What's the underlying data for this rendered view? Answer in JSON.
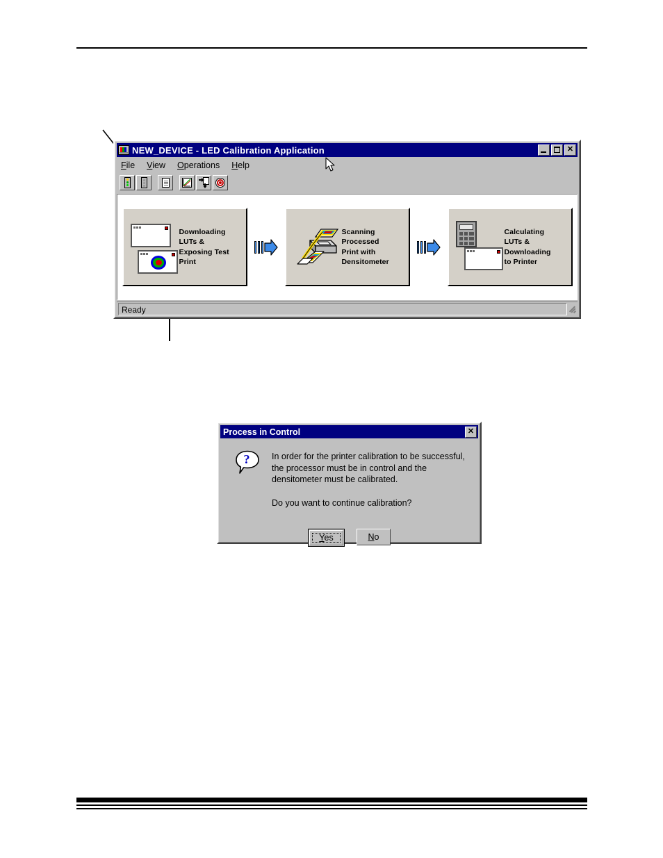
{
  "app_window": {
    "title": "NEW_DEVICE - LED Calibration Application",
    "title_icon": "device-screen-icon",
    "window_buttons": {
      "minimize": "minimize-button",
      "maximize": "maximize-button",
      "close_label": "✕"
    },
    "menu": [
      {
        "label": "File",
        "mnemonic": "F"
      },
      {
        "label": "View",
        "mnemonic": "V"
      },
      {
        "label": "Operations",
        "mnemonic": "O"
      },
      {
        "label": "Help",
        "mnemonic": "H"
      }
    ],
    "toolbar": [
      {
        "name": "status-light-on-button",
        "icon": "traffic-light-on-icon"
      },
      {
        "name": "status-light-off-button",
        "icon": "traffic-light-off-icon"
      },
      {
        "name": "report-button",
        "icon": "document-icon"
      },
      {
        "name": "curves-button",
        "icon": "graph-curve-icon"
      },
      {
        "name": "download-lut-button",
        "icon": "transfer-page-icon"
      },
      {
        "name": "calibrate-target-button",
        "icon": "bullseye-target-icon"
      }
    ],
    "flow_steps": [
      {
        "id": "step-downloading",
        "art": "monitor-and-test-print-icon",
        "lines": [
          "Downloading",
          "LUTs &",
          "Exposing Test",
          "Print"
        ]
      },
      {
        "id": "step-scanning",
        "art": "densitometer-scanner-icon",
        "lines": [
          "Scanning",
          "Processed",
          "Print with",
          "Densitometer"
        ]
      },
      {
        "id": "step-calculating",
        "art": "calculator-and-monitor-icon",
        "lines": [
          "Calculating",
          "LUTs &",
          "Downloading",
          "to Printer"
        ]
      }
    ],
    "flow_arrows": [
      "arrow-right-icon",
      "arrow-right-icon"
    ],
    "status_bar": {
      "text": "Ready",
      "grip": "resize-grip-icon"
    }
  },
  "dialog": {
    "title": "Process in Control",
    "close_label": "✕",
    "icon": "question-mark-icon",
    "message_paragraph_1": "In order for the printer calibration to be successful, the processor must be in control and the densitometer must be calibrated.",
    "message_paragraph_2": "Do you want to continue calibration?",
    "buttons": [
      {
        "label": "Yes",
        "mnemonic": "Y",
        "default": true
      },
      {
        "label": "No",
        "mnemonic": "N",
        "default": false
      }
    ]
  },
  "annotations": {
    "leader_to_toolbar": "callout-leader-line",
    "leader_to_step_one": "callout-leader-line"
  },
  "cursor": "mouse-pointer-icon",
  "colors": {
    "titlebar": "#000080",
    "face": "#c0c0c0",
    "step_face": "#d4d0c8",
    "arrow_blue": "#3c8ae8"
  }
}
